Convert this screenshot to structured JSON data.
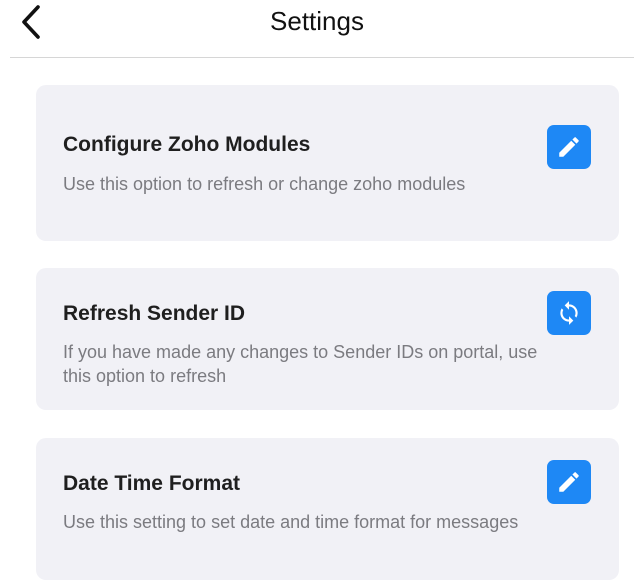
{
  "header": {
    "title": "Settings",
    "back_icon": "chevron-left-icon"
  },
  "accent_color": "#1e88f5",
  "card_background": "#f1f1f6",
  "cards": [
    {
      "title": "Configure Zoho Modules",
      "description": "Use this option to refresh or change zoho modules",
      "icon": "pencil-icon"
    },
    {
      "title": "Refresh Sender ID",
      "description": "If you have made any changes to Sender IDs on portal, use this option to refresh",
      "icon": "refresh-icon"
    },
    {
      "title": "Date Time Format",
      "description": "Use this setting to set date and time format for messages",
      "icon": "pencil-icon"
    }
  ]
}
